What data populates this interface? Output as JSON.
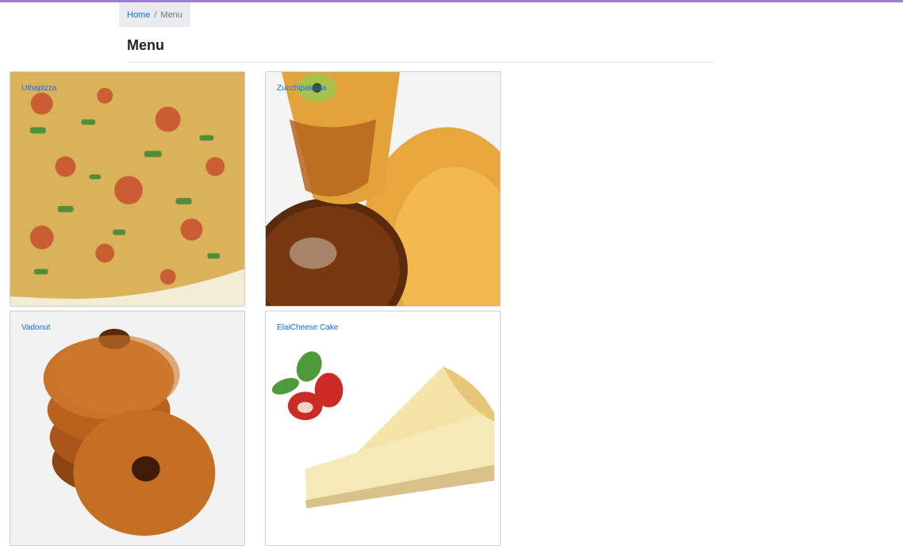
{
  "breadcrumb": {
    "home": "Home",
    "separator": "/",
    "current": "Menu"
  },
  "page": {
    "title": "Menu"
  },
  "dishes": [
    {
      "name": "Uthapizza"
    },
    {
      "name": "Zucchipakoda"
    },
    {
      "name": "Vadonut"
    },
    {
      "name": "ElaiCheese Cake"
    }
  ],
  "colors": {
    "accent_bar": "#9b7fd0",
    "link": "#0d6efd"
  }
}
